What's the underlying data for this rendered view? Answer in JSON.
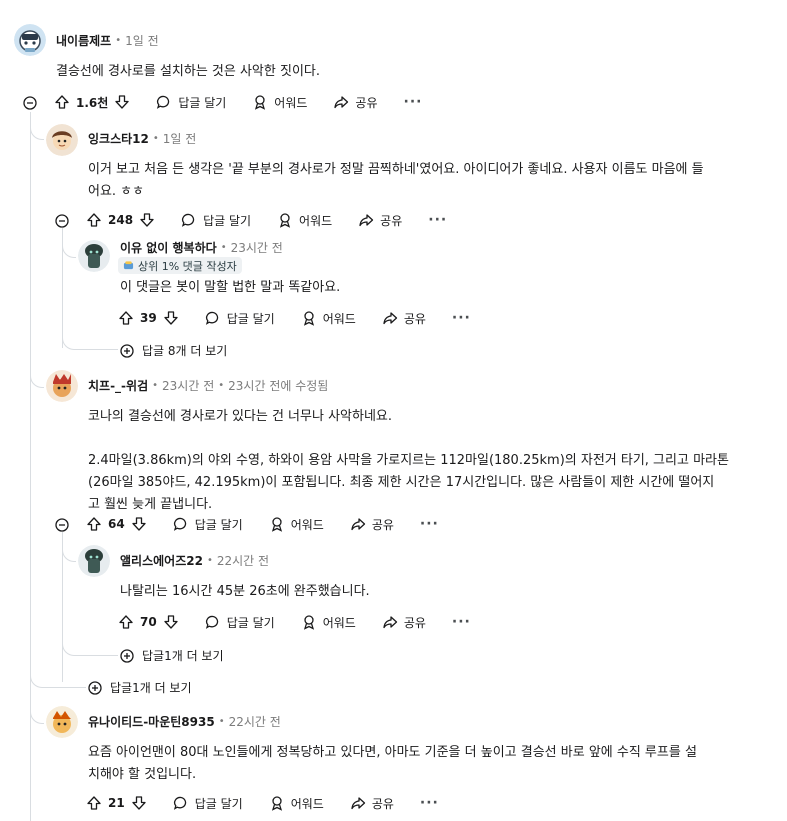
{
  "icons": {
    "upvote": "upvote-arrow-icon",
    "downvote": "downvote-arrow-icon",
    "reply": "speech-bubble-icon",
    "award": "award-ribbon-icon",
    "share": "share-arrow-icon",
    "more": "more-dots-icon",
    "collapse": "minus-circle-icon",
    "expand": "plus-circle-icon"
  },
  "colors": {
    "thread_line": "#d9dde1",
    "meta": "#7c7c7c",
    "text": "#1a1a1b"
  },
  "actions": {
    "reply": "답글 달기",
    "award": "어워드",
    "share": "공유",
    "more": "···"
  },
  "comments": [
    {
      "author": "내이름제프",
      "time": "1일 전",
      "text": "결승선에 경사로를 설치하는 것은 사악한 짓이다.",
      "votes": "1.6천"
    },
    {
      "author": "잉크스타12",
      "time": "1일 전",
      "text": "이거 보고 처음 든 생각은 '끝 부분의 경사로가 정말 끔찍하네'였어요. 아이디어가 좋네요. 사용자 이름도 마음에 들\n어요. ㅎㅎ",
      "votes": "248"
    },
    {
      "author": "이유 없이 행복하다",
      "time": "23시간 전",
      "badge": "상위 1% 댓글 작성자",
      "text": "이 댓글은 봇이 말할 법한 말과 똑같아요.",
      "votes": "39",
      "more_replies": "답글 8개 더 보기"
    },
    {
      "author": "치프-_-위검",
      "time": "23시간 전",
      "edited": "23시간 전에 수정됨",
      "text": "코나의 결승선에 경사로가 있다는 건 너무나 사악하네요.\n\n2.4마일(3.86km)의 야외 수영, 하와이 용암 사막을 가로지르는 112마일(180.25km)의 자전거 타기, 그리고 마라톤\n(26마일 385야드, 42.195km)이 포함됩니다. 최종 제한 시간은 17시간입니다. 많은 사람들이 제한 시간에 떨어지\n고 훨씬 늦게 끝냅니다.",
      "votes": "64"
    },
    {
      "author": "앨리스에어즈22",
      "time": "22시간 전",
      "text": "나탈리는 16시간 45분 26초에 완주했습니다.",
      "votes": "70",
      "more_replies": "답글1개 더 보기"
    },
    {
      "author": "유나이티드-마운틴8935",
      "time": "22시간 전",
      "text": "요즘 아이언맨이 80대 노인들에게 정복당하고 있다면, 아마도 기준을 더 높이고 결승선 바로 앞에 수직 루프를 설\n치해야 할 것입니다.",
      "votes": "21"
    }
  ],
  "thread_more_replies": "답글1개 더 보기"
}
